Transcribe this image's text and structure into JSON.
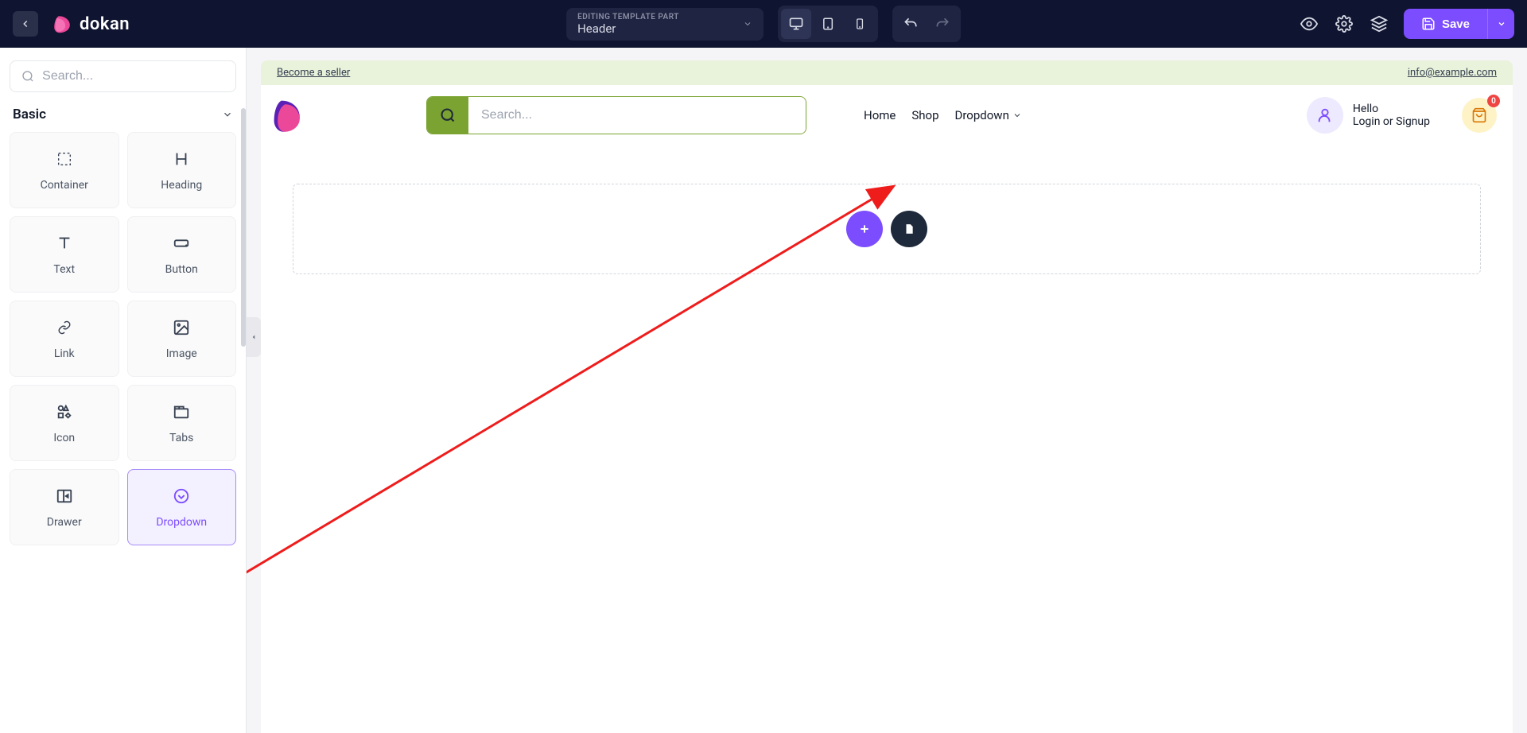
{
  "topbar": {
    "logo_text": "dokan",
    "template_label": "EDITING TEMPLATE PART",
    "template_value": "Header",
    "save_label": "Save"
  },
  "sidebar": {
    "search_placeholder": "Search...",
    "section_title": "Basic",
    "widgets": [
      {
        "label": "Container"
      },
      {
        "label": "Heading"
      },
      {
        "label": "Text"
      },
      {
        "label": "Button"
      },
      {
        "label": "Link"
      },
      {
        "label": "Image"
      },
      {
        "label": "Icon"
      },
      {
        "label": "Tabs"
      },
      {
        "label": "Drawer"
      },
      {
        "label": "Dropdown"
      }
    ]
  },
  "preview": {
    "announce_left": "Become a seller",
    "announce_right": "info@example.com",
    "search_placeholder": "Search...",
    "nav": {
      "home": "Home",
      "shop": "Shop",
      "dropdown": "Dropdown"
    },
    "user_greeting": "Hello",
    "user_action": "Login or Signup",
    "cart_count": "0"
  }
}
